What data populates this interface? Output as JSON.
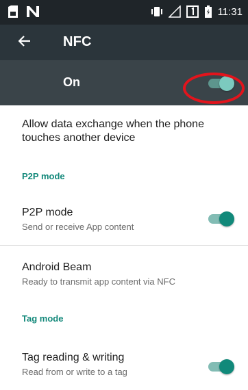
{
  "status_bar": {
    "time": "11:31",
    "left_icons": [
      "sim-card-icon",
      "nfc-n-icon"
    ],
    "right_icons": [
      "vibrate-icon",
      "signal-icon",
      "sim-1-icon",
      "battery-icon"
    ]
  },
  "toolbar": {
    "back_icon": "arrow-back-icon",
    "title": "NFC"
  },
  "master_switch": {
    "label": "On",
    "checked": true
  },
  "description": "Allow data exchange when the phone touches another device",
  "sections": [
    {
      "header": "P2P mode",
      "items": [
        {
          "title": "P2P mode",
          "summary": "Send or receive App content",
          "switch": true
        }
      ]
    },
    {
      "header": "",
      "items": [
        {
          "title": "Android Beam",
          "summary": "Ready to transmit app content via NFC",
          "switch": null
        }
      ]
    },
    {
      "header": "Tag mode",
      "items": [
        {
          "title": "Tag reading & writing",
          "summary": "Read from or write to a tag",
          "switch": true
        }
      ]
    }
  ],
  "colors": {
    "status_bar": "#1f2529",
    "toolbar": "#2b353b",
    "master_bar": "#3a4449",
    "accent": "#14897b",
    "annotation": "#e3141c"
  }
}
